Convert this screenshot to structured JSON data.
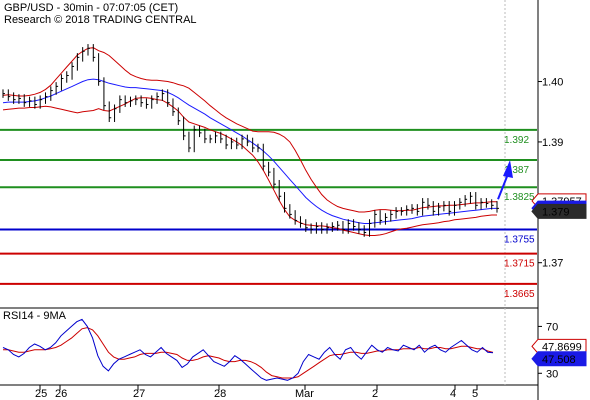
{
  "header": {
    "line1": "GBP/USD - 30min - 07:07:05 (CET)",
    "line2": "Research © 2018 TRADING CENTRAL"
  },
  "indicator_label": "RSI14 - 9MA",
  "colors": {
    "green": "#1f8f1f",
    "blue": "#0000cc",
    "red": "#cc0000",
    "price": "#000000",
    "band": "#cc0000",
    "ma": "#1a1aff",
    "dark_box": "#2b2b2b",
    "blue_box": "#1a1ae6",
    "red_box": "#cc0000",
    "arrow": "#1a1aff"
  },
  "chart_data": [
    {
      "type": "candlestick",
      "pair": "GBP/USD",
      "timeframe": "30min",
      "y_ticks": [
        {
          "value": 1.4,
          "label": "1.40"
        },
        {
          "value": 1.39,
          "label": "1.39"
        },
        {
          "value": 1.38,
          "label": "1.38"
        },
        {
          "value": 1.37,
          "label": "1.37"
        }
      ],
      "x_ticks": [
        "25",
        "26",
        "27",
        "28",
        "Mar",
        "2",
        "4",
        "5"
      ],
      "ylim": [
        1.3625,
        1.4135
      ],
      "levels": [
        {
          "value": 1.392,
          "label": "1.392",
          "color": "green"
        },
        {
          "value": 1.387,
          "label": "1.387",
          "color": "green"
        },
        {
          "value": 1.3825,
          "label": "1.3825",
          "color": "green"
        },
        {
          "value": 1.3755,
          "label": "1.3755",
          "color": "blue"
        },
        {
          "value": 1.3715,
          "label": "1.3715",
          "color": "red"
        },
        {
          "value": 1.3665,
          "label": "1.3665",
          "color": "red"
        }
      ],
      "price_boxes": [
        {
          "value": 1.37957,
          "label": "1.37957",
          "style": "red"
        },
        {
          "value": 1.37903,
          "label": "1.37903",
          "style": "blue"
        },
        {
          "value": 1.379,
          "label": "1.379",
          "style": "dark"
        }
      ],
      "arrow": {
        "from": 1.3805,
        "to": 1.387
      },
      "close": [
        1.398,
        1.3975,
        1.397,
        1.3972,
        1.3965,
        1.3968,
        1.3962,
        1.397,
        1.3975,
        1.3985,
        1.3992,
        1.4005,
        1.401,
        1.4025,
        1.404,
        1.405,
        1.4055,
        1.404,
        1.4,
        1.396,
        1.394,
        1.3955,
        1.397,
        1.3965,
        1.3968,
        1.397,
        1.3965,
        1.3962,
        1.397,
        1.3975,
        1.398,
        1.3965,
        1.395,
        1.3935,
        1.391,
        1.389,
        1.392,
        1.3915,
        1.3905,
        1.3905,
        1.391,
        1.3905,
        1.3895,
        1.39,
        1.3895,
        1.3905,
        1.39,
        1.389,
        1.389,
        1.386,
        1.385,
        1.383,
        1.381,
        1.379,
        1.378,
        1.377,
        1.3765,
        1.3758,
        1.3755,
        1.376,
        1.3755,
        1.3758,
        1.376,
        1.3762,
        1.3755,
        1.3765,
        1.376,
        1.3755,
        1.375,
        1.3765,
        1.378,
        1.377,
        1.3775,
        1.378,
        1.3785,
        1.3785,
        1.3788,
        1.379,
        1.3785,
        1.38,
        1.3795,
        1.3785,
        1.3792,
        1.3795,
        1.3785,
        1.3795,
        1.38,
        1.3805,
        1.381,
        1.3795,
        1.38,
        1.3798,
        1.3795,
        1.379
      ],
      "ma": [
        1.3965,
        1.3966,
        1.3966,
        1.3966,
        1.3966,
        1.3967,
        1.3968,
        1.397,
        1.3973,
        1.3976,
        1.398,
        1.3984,
        1.3988,
        1.3992,
        1.3996,
        1.4,
        1.4003,
        1.4004,
        1.4003,
        1.4,
        1.3997,
        1.3995,
        1.3993,
        1.3991,
        1.399,
        1.399,
        1.3989,
        1.3988,
        1.3987,
        1.3986,
        1.3985,
        1.3982,
        1.3978,
        1.3973,
        1.3967,
        1.3961,
        1.3956,
        1.3951,
        1.3946,
        1.394,
        1.3935,
        1.393,
        1.3925,
        1.392,
        1.3915,
        1.391,
        1.3904,
        1.3898,
        1.3892,
        1.3885,
        1.3877,
        1.3868,
        1.3858,
        1.3848,
        1.3838,
        1.3828,
        1.3818,
        1.3808,
        1.38,
        1.3793,
        1.3787,
        1.3782,
        1.3778,
        1.3775,
        1.3772,
        1.377,
        1.3768,
        1.3766,
        1.3765,
        1.3765,
        1.3766,
        1.3767,
        1.3768,
        1.3769,
        1.377,
        1.3771,
        1.3772,
        1.3773,
        1.3775,
        1.3777,
        1.3778,
        1.3779,
        1.378,
        1.3781,
        1.3782,
        1.3783,
        1.3784,
        1.3785,
        1.3786,
        1.3787,
        1.3788,
        1.3789,
        1.379,
        1.379
      ],
      "band_width": [
        0.0012,
        0.0012,
        0.0011,
        0.001,
        0.001,
        0.001,
        0.0011,
        0.0012,
        0.0014,
        0.0018,
        0.0024,
        0.003,
        0.0036,
        0.0042,
        0.0048,
        0.005,
        0.0052,
        0.0052,
        0.0048,
        0.0048,
        0.0046,
        0.004,
        0.0034,
        0.0028,
        0.0022,
        0.0018,
        0.0016,
        0.0015,
        0.0015,
        0.0016,
        0.0016,
        0.0018,
        0.002,
        0.0022,
        0.0026,
        0.0028,
        0.0026,
        0.0024,
        0.0022,
        0.002,
        0.0018,
        0.0016,
        0.0015,
        0.0015,
        0.0015,
        0.0016,
        0.0018,
        0.002,
        0.0025,
        0.0032,
        0.004,
        0.0048,
        0.0055,
        0.006,
        0.0062,
        0.0058,
        0.0052,
        0.0045,
        0.0038,
        0.0032,
        0.0026,
        0.0022,
        0.002,
        0.0018,
        0.0018,
        0.0018,
        0.0018,
        0.0018,
        0.0019,
        0.002,
        0.0021,
        0.0021,
        0.002,
        0.0018,
        0.0016,
        0.0015,
        0.0015,
        0.0014,
        0.0014,
        0.0014,
        0.0014,
        0.0014,
        0.0014,
        0.0013,
        0.0013,
        0.0012,
        0.0012,
        0.0012,
        0.0012,
        0.0012,
        0.0011,
        0.0011,
        0.0011,
        0.0011
      ]
    },
    {
      "type": "line",
      "title": "RSI14 - 9MA",
      "y_ticks": [
        {
          "value": 70,
          "label": "70"
        },
        {
          "value": 30,
          "label": "30"
        }
      ],
      "ylim": [
        20,
        84
      ],
      "price_boxes": [
        {
          "value": 47.8699,
          "label": "47.8699",
          "style": "red"
        },
        {
          "value": 47.508,
          "label": "47.508",
          "style": "blue"
        }
      ],
      "rsi": [
        52,
        50,
        46,
        44,
        47,
        52,
        55,
        53,
        50,
        52,
        56,
        62,
        66,
        70,
        74,
        76,
        70,
        60,
        45,
        36,
        32,
        38,
        42,
        44,
        46,
        48,
        50,
        46,
        44,
        48,
        52,
        47,
        44,
        41,
        35,
        38,
        44,
        47,
        50,
        45,
        40,
        38,
        36,
        40,
        45,
        42,
        38,
        34,
        30,
        26,
        24,
        25,
        26,
        25,
        24,
        26,
        30,
        40,
        46,
        44,
        42,
        48,
        52,
        46,
        42,
        50,
        52,
        46,
        42,
        48,
        54,
        50,
        48,
        52,
        50,
        49,
        54,
        52,
        50,
        54,
        48,
        52,
        54,
        50,
        48,
        52,
        55,
        58,
        54,
        50,
        48,
        52,
        47.9,
        47.5
      ],
      "rsi_ma": [
        50,
        50,
        49,
        48,
        48,
        49,
        50,
        50,
        50,
        51,
        52,
        54,
        57,
        60,
        64,
        68,
        69,
        67,
        62,
        55,
        48,
        44,
        42,
        42,
        43,
        44,
        46,
        47,
        47,
        47,
        48,
        48,
        47,
        46,
        43,
        41,
        41,
        42,
        44,
        45,
        44,
        43,
        41,
        40,
        40,
        41,
        41,
        40,
        38,
        35,
        31,
        28,
        27,
        26,
        26,
        26,
        27,
        30,
        33,
        36,
        39,
        42,
        45,
        46,
        46,
        47,
        48,
        48,
        47,
        47,
        48,
        49,
        49,
        50,
        50,
        50,
        51,
        51,
        51,
        52,
        51,
        51,
        52,
        52,
        51,
        51,
        52,
        53,
        53,
        52,
        51,
        51,
        49,
        47.9
      ]
    }
  ]
}
